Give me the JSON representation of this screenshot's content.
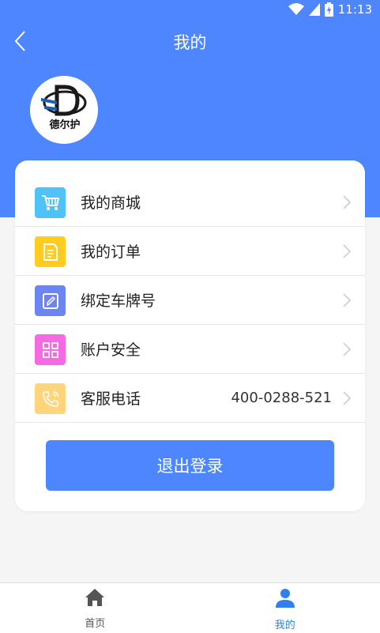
{
  "status_bar": {
    "time": "11:13",
    "icons": [
      "wifi-icon",
      "signal-icon",
      "battery-charging-icon"
    ]
  },
  "header": {
    "title": "我的",
    "back_icon": "chevron-left-icon"
  },
  "profile": {
    "avatar_logo_text": "德尔护"
  },
  "menu": [
    {
      "label": "我的商城",
      "icon": "cart-icon",
      "color": "#4fc3f7"
    },
    {
      "label": "我的订单",
      "icon": "document-icon",
      "color": "#ffcc1f"
    },
    {
      "label": "绑定车牌号",
      "icon": "edit-icon",
      "color": "#6b86f2"
    },
    {
      "label": "账户安全",
      "icon": "grid-icon",
      "color": "#f56ae0"
    },
    {
      "label": "客服电话",
      "value": "400-0288-521",
      "icon": "phone-icon",
      "color": "#ffd47a"
    }
  ],
  "logout_label": "退出登录",
  "bottom_nav": {
    "items": [
      {
        "label": "首页",
        "icon": "home-icon",
        "active": false
      },
      {
        "label": "我的",
        "icon": "user-icon",
        "active": true
      }
    ],
    "active_color": "#2f80ed",
    "inactive_color": "#555555"
  },
  "colors": {
    "primary": "#4d86ff",
    "background": "#f5f5f5"
  }
}
